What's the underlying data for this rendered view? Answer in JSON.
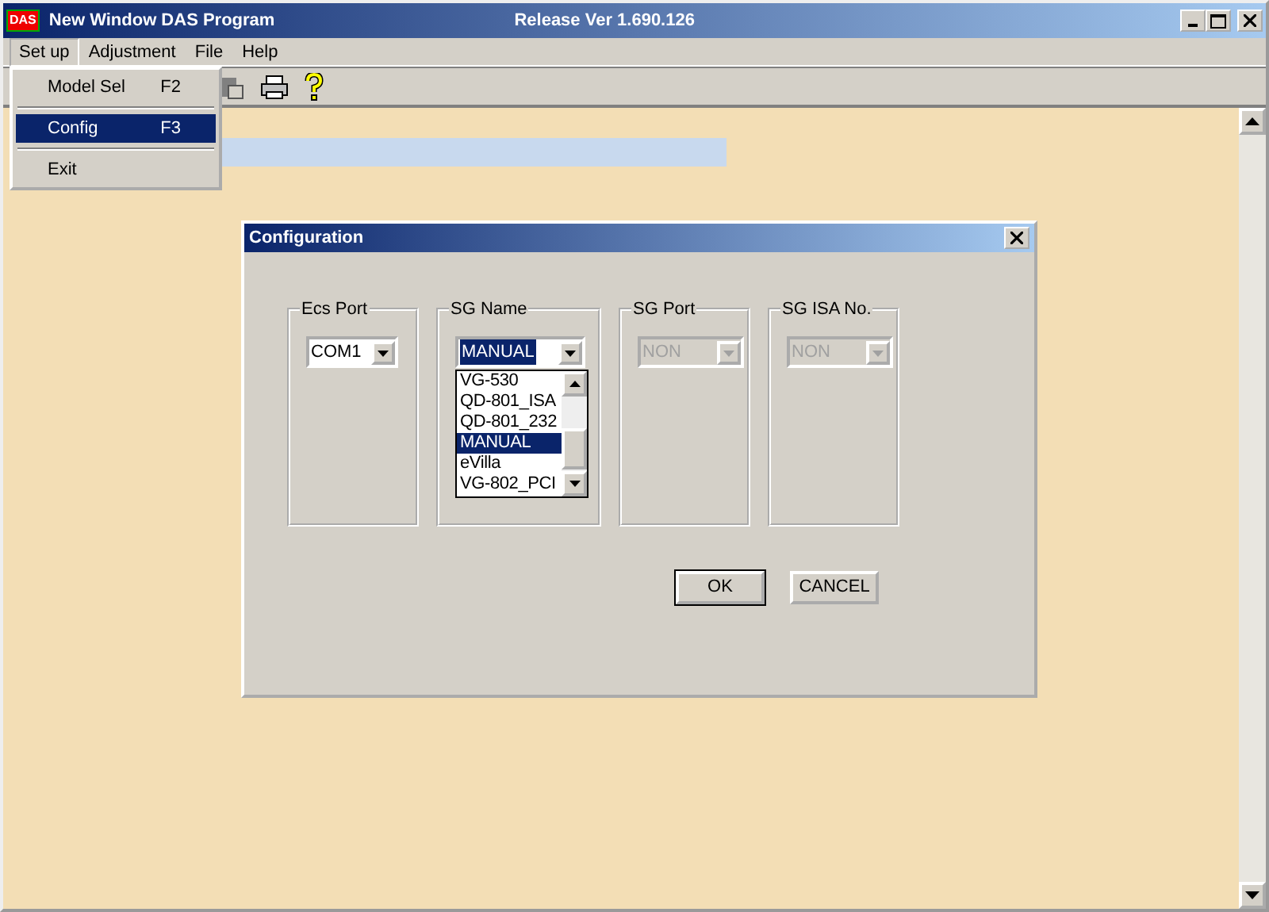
{
  "window": {
    "logo": "DAS",
    "title": "New Window DAS Program",
    "release": "Release Ver 1.690.126"
  },
  "menu": [
    {
      "label": "Set up",
      "selected": true
    },
    {
      "label": "Adjustment",
      "selected": false
    },
    {
      "label": "File",
      "selected": false
    },
    {
      "label": "Help",
      "selected": false
    }
  ],
  "dropdown": [
    {
      "kind": "item",
      "label": "Model Sel",
      "shortcut": "F2",
      "selected": false
    },
    {
      "kind": "separator"
    },
    {
      "kind": "item",
      "label": "Config",
      "shortcut": "F3",
      "selected": true
    },
    {
      "kind": "separator"
    },
    {
      "kind": "item",
      "label": "Exit",
      "selected": false
    }
  ],
  "dialog": {
    "title": "Configuration",
    "groups": [
      {
        "label": "Ecs Port",
        "value": "COM1",
        "disabled": false,
        "focused": false
      },
      {
        "label": "SG Name",
        "value": "MANUAL",
        "disabled": false,
        "focused": true,
        "options": [
          {
            "label": "VG-530",
            "selected": false
          },
          {
            "label": "QD-801_ISA",
            "selected": false
          },
          {
            "label": "QD-801_232",
            "selected": false
          },
          {
            "label": "MANUAL",
            "selected": true
          },
          {
            "label": "eVilla",
            "selected": false
          },
          {
            "label": "VG-802_PCI",
            "selected": false
          }
        ]
      },
      {
        "label": "SG Port",
        "value": "NON",
        "disabled": true,
        "focused": false
      },
      {
        "label": "SG ISA No.",
        "value": "NON",
        "disabled": true,
        "focused": false
      }
    ],
    "buttons": [
      {
        "label": "OK",
        "default": true
      },
      {
        "label": "CANCEL",
        "default": false
      }
    ]
  }
}
